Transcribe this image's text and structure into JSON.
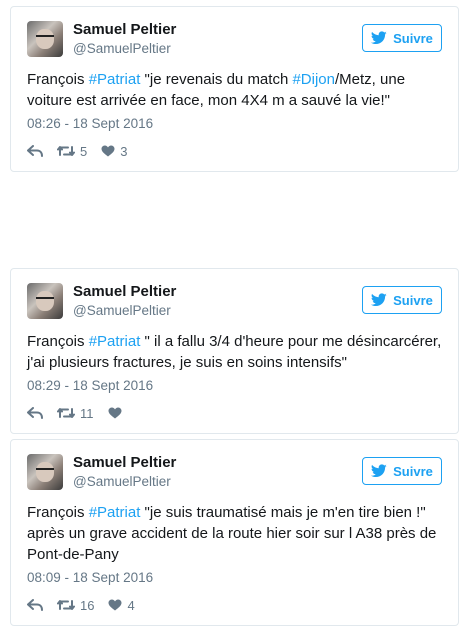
{
  "tweets": [
    {
      "name": "Samuel Peltier",
      "handle": "@SamuelPeltier",
      "follow_label": "Suivre",
      "segments": [
        {
          "t": "François ",
          "tag": false
        },
        {
          "t": "#Patriat",
          "tag": true
        },
        {
          "t": " \"je revenais du match ",
          "tag": false
        },
        {
          "t": "#Dijon",
          "tag": true
        },
        {
          "t": "/Metz, une voiture est arrivée en face, mon 4X4 m a sauvé la vie!\"",
          "tag": false
        }
      ],
      "time": "08:26 - 18 Sept 2016",
      "retweets": "5",
      "likes": "3"
    },
    {
      "name": "Samuel Peltier",
      "handle": "@SamuelPeltier",
      "follow_label": "Suivre",
      "segments": [
        {
          "t": "François ",
          "tag": false
        },
        {
          "t": "#Patriat",
          "tag": true
        },
        {
          "t": " \" il a fallu 3/4 d'heure pour me désincarcérer, j'ai plusieurs fractures, je suis en soins intensifs\"",
          "tag": false
        }
      ],
      "time": "08:29 - 18 Sept 2016",
      "retweets": "11",
      "likes": ""
    },
    {
      "name": "Samuel Peltier",
      "handle": "@SamuelPeltier",
      "follow_label": "Suivre",
      "segments": [
        {
          "t": "François ",
          "tag": false
        },
        {
          "t": "#Patriat",
          "tag": true
        },
        {
          "t": " \"je suis traumatisé mais je m'en tire bien !\" après un grave accident de la route hier soir sur l A38 près de Pont-de-Pany",
          "tag": false
        }
      ],
      "time": "08:09 - 18 Sept 2016",
      "retweets": "16",
      "likes": "4"
    }
  ],
  "colors": {
    "accent": "#1da1f2",
    "muted": "#657786",
    "text": "#14171a",
    "border": "#e1e8ed"
  },
  "icons": {
    "follow": "twitter-bird-icon",
    "reply": "reply-icon",
    "retweet": "retweet-icon",
    "like": "heart-icon"
  }
}
